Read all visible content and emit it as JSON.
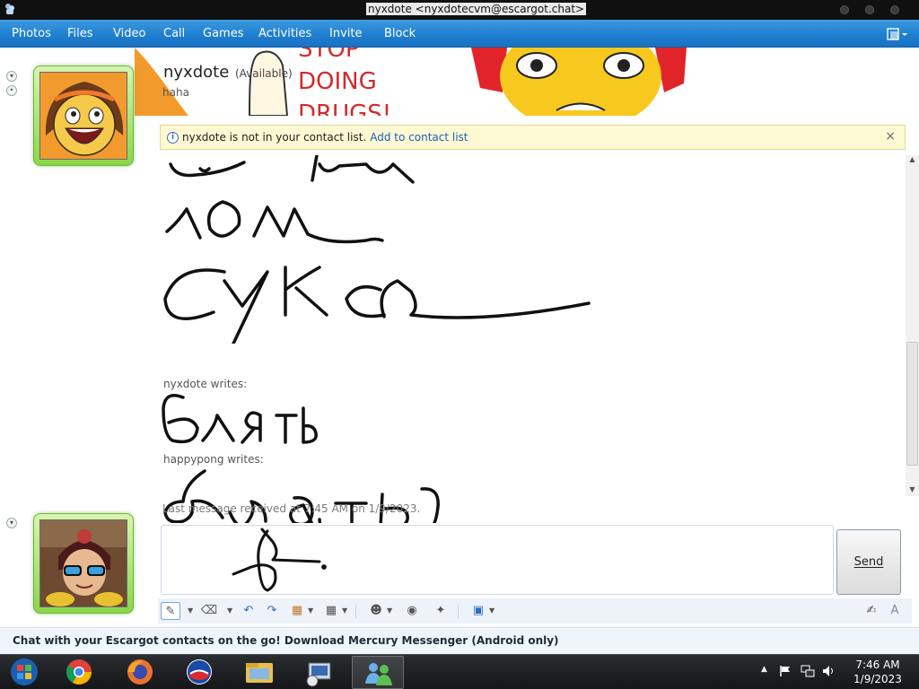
{
  "window": {
    "title": "nyxdote <nyxdotecvm@escargot.chat>"
  },
  "menu": {
    "items": [
      "Photos",
      "Files",
      "Video",
      "Call",
      "Games",
      "Activities",
      "Invite",
      "Block"
    ],
    "options_icon": "options-icon"
  },
  "contact": {
    "name": "nyxdote",
    "status": "(Available)",
    "personal_message": "haha"
  },
  "banner": {
    "text_lines": [
      "STOP",
      "DOING",
      "DRUGS!"
    ]
  },
  "notice": {
    "message": "nyxdote is not in your contact list.",
    "link": "Add to contact list",
    "close": "×"
  },
  "conversation": {
    "messages": [
      {
        "sender_label": "nyxdote writes:",
        "ink_icon": "handwritten-ink"
      },
      {
        "sender_label": "happypong writes:",
        "ink_icon": "handwritten-ink"
      }
    ],
    "last_message": "Last message received at 7:45 AM on 1/9/2023."
  },
  "compose": {
    "send_label": "Send"
  },
  "toolbar": {
    "tools": [
      "pen-icon",
      "eraser-icon",
      "undo-icon",
      "redo-icon",
      "grid-color-icon",
      "grid-icon",
      "emoticon-icon",
      "voice-clip-icon",
      "nudge-icon",
      "background-icon",
      "handwriting-icon",
      "text-icon"
    ]
  },
  "ad": {
    "text": "Chat with your Escargot contacts on the go! Download Mercury Messenger (Android only)"
  },
  "taskbar": {
    "apps": [
      "windows-start-icon",
      "chrome-icon",
      "firefox-icon",
      "obama-icon",
      "explorer-icon",
      "network-tool-icon",
      "messenger-icon"
    ],
    "clock_time": "7:46 AM",
    "clock_date": "1/9/2023"
  }
}
